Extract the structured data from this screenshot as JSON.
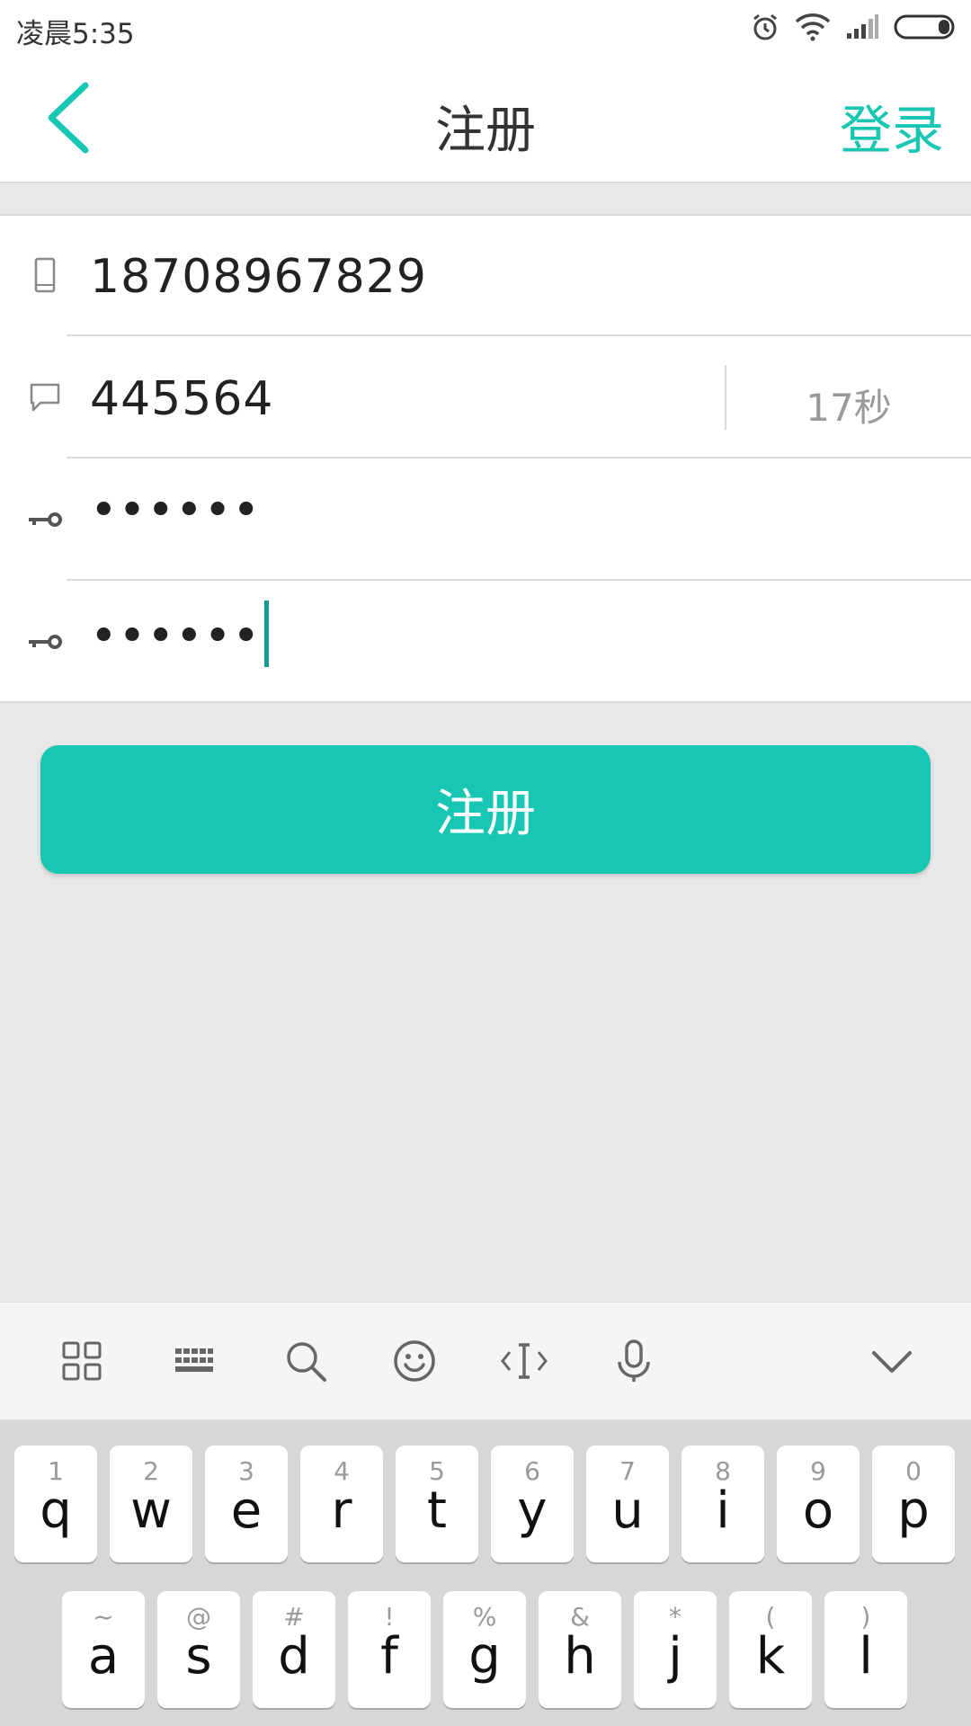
{
  "status_bar": {
    "time": "凌晨5:35",
    "icons": [
      "alarm-icon",
      "wifi-icon",
      "signal-icon",
      "battery-icon"
    ]
  },
  "header": {
    "title": "注册",
    "back_icon": "chevron-left-icon",
    "login_label": "登录"
  },
  "form": {
    "phone": {
      "icon": "phone-icon",
      "value": "18708967829"
    },
    "code": {
      "icon": "message-icon",
      "value": "445564",
      "countdown": "17秒"
    },
    "password": {
      "icon": "key-icon",
      "value": "••••••"
    },
    "confirm_password": {
      "icon": "key-icon",
      "value": "••••••"
    }
  },
  "register_button": {
    "label": "注册"
  },
  "keyboard_toolbar": {
    "icons": [
      "grid-icon",
      "keyboard-icon",
      "search-icon",
      "emoji-icon",
      "cursor-icon",
      "microphone-icon",
      "chevron-down-icon"
    ]
  },
  "keyboard": {
    "row1": [
      {
        "hint": "1",
        "letter": "q"
      },
      {
        "hint": "2",
        "letter": "w"
      },
      {
        "hint": "3",
        "letter": "e"
      },
      {
        "hint": "4",
        "letter": "r"
      },
      {
        "hint": "5",
        "letter": "t"
      },
      {
        "hint": "6",
        "letter": "y"
      },
      {
        "hint": "7",
        "letter": "u"
      },
      {
        "hint": "8",
        "letter": "i"
      },
      {
        "hint": "9",
        "letter": "o"
      },
      {
        "hint": "0",
        "letter": "p"
      }
    ],
    "row2": [
      {
        "hint": "~",
        "letter": "a"
      },
      {
        "hint": "@",
        "letter": "s"
      },
      {
        "hint": "#",
        "letter": "d"
      },
      {
        "hint": "!",
        "letter": "f"
      },
      {
        "hint": "%",
        "letter": "g"
      },
      {
        "hint": "&",
        "letter": "h"
      },
      {
        "hint": "*",
        "letter": "j"
      },
      {
        "hint": "(",
        "letter": "k"
      },
      {
        "hint": ")",
        "letter": "l"
      }
    ]
  },
  "colors": {
    "accent": "#17c7b3",
    "background": "#e8e8e8",
    "caret": "#139c8f"
  }
}
